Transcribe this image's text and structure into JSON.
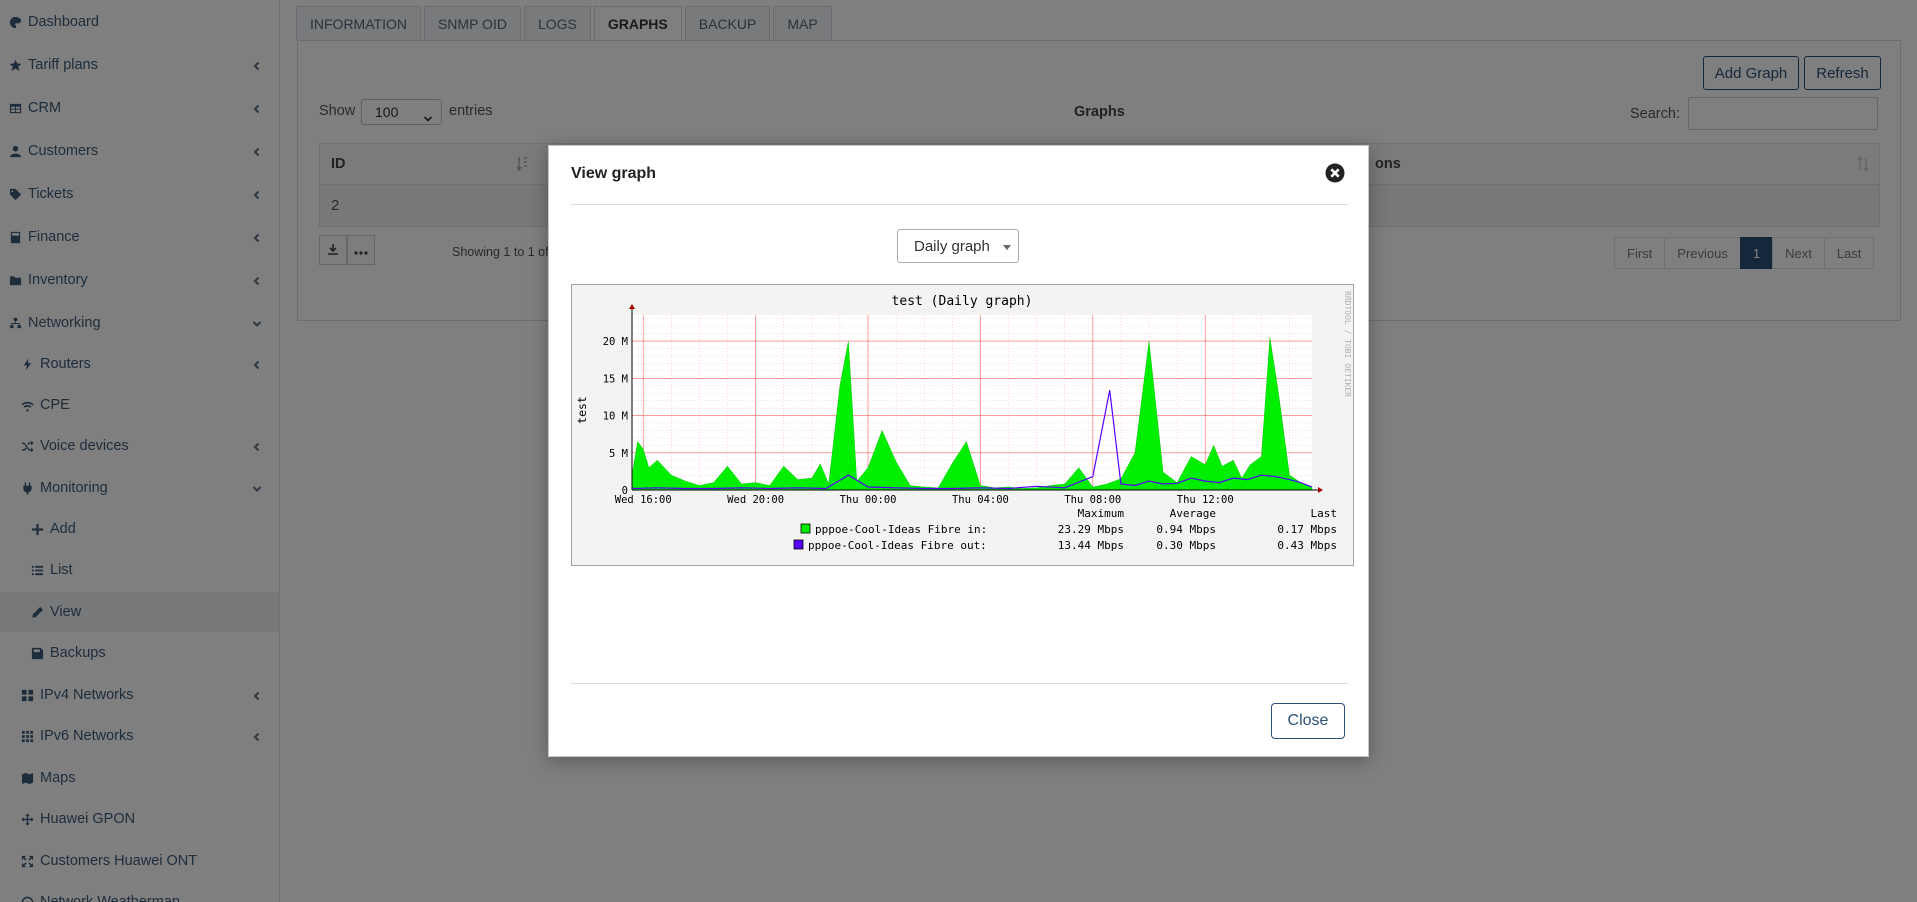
{
  "sidebar": {
    "items": [
      {
        "label": "Dashboard",
        "icon": "palette-icon",
        "caret": false
      },
      {
        "label": "Tariff plans",
        "icon": "star-icon",
        "caret": true
      },
      {
        "label": "CRM",
        "icon": "table-icon",
        "caret": true
      },
      {
        "label": "Customers",
        "icon": "user-icon",
        "caret": true
      },
      {
        "label": "Tickets",
        "icon": "tag-icon",
        "caret": true
      },
      {
        "label": "Finance",
        "icon": "calculator-icon",
        "caret": true
      },
      {
        "label": "Inventory",
        "icon": "folder-icon",
        "caret": true
      },
      {
        "label": "Networking",
        "icon": "network-icon",
        "caret": true,
        "open": true
      },
      {
        "label": "Routers",
        "icon": "bolt-icon",
        "caret": true
      },
      {
        "label": "CPE",
        "icon": "wifi-icon",
        "caret": false
      },
      {
        "label": "Voice devices",
        "icon": "shuffle-icon",
        "caret": true
      },
      {
        "label": "Monitoring",
        "icon": "plug-icon",
        "caret": true,
        "open": true
      },
      {
        "label": "Add",
        "icon": "plus-icon",
        "caret": false
      },
      {
        "label": "List",
        "icon": "list-icon",
        "caret": false
      },
      {
        "label": "View",
        "icon": "pencil-icon",
        "caret": false,
        "active": true
      },
      {
        "label": "Backups",
        "icon": "disk-icon",
        "caret": false
      },
      {
        "label": "IPv4 Networks",
        "icon": "grid-icon",
        "caret": true
      },
      {
        "label": "IPv6 Networks",
        "icon": "grid-small-icon",
        "caret": true
      },
      {
        "label": "Maps",
        "icon": "map-icon",
        "caret": false
      },
      {
        "label": "Huawei GPON",
        "icon": "arrows-icon",
        "caret": false
      },
      {
        "label": "Customers Huawei ONT",
        "icon": "expand-icon",
        "caret": false
      },
      {
        "label": "Network Weathermap",
        "icon": "circle-icon",
        "caret": false
      }
    ]
  },
  "tabs": [
    "INFORMATION",
    "SNMP OID",
    "LOGS",
    "GRAPHS",
    "BACKUP",
    "MAP"
  ],
  "active_tab": "GRAPHS",
  "panel": {
    "add_graph": "Add Graph",
    "refresh": "Refresh",
    "show_label": "Show",
    "show_value": "100",
    "entries_label": "entries",
    "table_title": "Graphs",
    "search_label": "Search:",
    "col_id": "ID",
    "col_actions_partial": "ons",
    "row_id": "2",
    "showing": "Showing 1 to 1 of",
    "pager": [
      "First",
      "Previous",
      "1",
      "Next",
      "Last"
    ]
  },
  "modal": {
    "title": "View graph",
    "select_value": "Daily graph",
    "close_label": "Close"
  },
  "colors": {
    "accent": "#2b5177",
    "in_fill": "#00ee00",
    "out_line": "#5500ff",
    "grid_minor": "#ffaaaa"
  },
  "chart_data": {
    "type": "area",
    "title": "test (Daily graph)",
    "ylabel": "test",
    "watermark": "RRDTOOL / TOBI OETIKER",
    "y_ticks": [
      "0",
      "5 M",
      "10 M",
      "15 M",
      "20 M"
    ],
    "ylim": [
      0,
      23.5
    ],
    "x_ticks": [
      "Wed 16:00",
      "Wed 20:00",
      "Thu 00:00",
      "Thu 04:00",
      "Thu 08:00",
      "Thu 12:00"
    ],
    "xlim_hours": [
      15.6,
      39.8
    ],
    "legend_headers": [
      "Maximum",
      "Average",
      "Last"
    ],
    "series": [
      {
        "name": "pppoe-Cool-Ideas Fibre in:",
        "maximum": "23.29 Mbps",
        "average": "0.94 Mbps",
        "last": "0.17 Mbps",
        "x": [
          15.6,
          15.8,
          16.0,
          16.2,
          16.5,
          17.0,
          17.5,
          18.0,
          18.5,
          19.0,
          19.5,
          20.0,
          20.5,
          21.0,
          21.5,
          22.0,
          22.3,
          22.6,
          23.0,
          23.3,
          23.6,
          24.0,
          24.5,
          25.0,
          25.5,
          26.0,
          26.5,
          27.0,
          27.5,
          28.0,
          28.5,
          29.0,
          29.5,
          30.0,
          30.5,
          31.0,
          31.5,
          32.0,
          32.5,
          33.0,
          33.5,
          34.0,
          34.5,
          35.0,
          35.5,
          36.0,
          36.3,
          36.6,
          37.0,
          37.3,
          37.6,
          38.0,
          38.3,
          38.6,
          39.0,
          39.4,
          39.8
        ],
        "y": [
          2.0,
          6.5,
          5.5,
          3.0,
          4.0,
          2.0,
          1.2,
          0.6,
          1.0,
          3.2,
          0.8,
          1.0,
          0.6,
          3.2,
          1.4,
          1.6,
          3.5,
          0.8,
          14.0,
          20.0,
          1.2,
          3.0,
          8.0,
          3.8,
          0.6,
          0.4,
          0.3,
          3.6,
          6.5,
          0.6,
          0.3,
          0.4,
          0.2,
          0.3,
          0.6,
          0.8,
          3.0,
          0.4,
          0.8,
          1.5,
          5.0,
          20.0,
          2.4,
          1.0,
          4.5,
          3.4,
          6.0,
          3.2,
          4.0,
          1.6,
          3.4,
          4.5,
          20.5,
          13.2,
          2.0,
          1.0,
          0.3
        ]
      },
      {
        "name": "pppoe-Cool-Ideas Fibre out:",
        "maximum": "13.44 Mbps",
        "average": "0.30 Mbps",
        "last": "0.43 Mbps",
        "x": [
          15.6,
          16.5,
          17.5,
          18.5,
          19.5,
          20.5,
          21.5,
          22.5,
          23.3,
          24.0,
          25.0,
          26.0,
          27.0,
          28.0,
          29.0,
          30.0,
          31.0,
          32.0,
          32.6,
          33.0,
          33.5,
          34.0,
          34.5,
          35.0,
          35.5,
          36.0,
          36.5,
          37.0,
          37.5,
          38.0,
          38.5,
          39.0,
          39.4,
          39.8
        ],
        "y": [
          0.2,
          0.3,
          0.2,
          0.2,
          0.3,
          0.2,
          0.3,
          0.2,
          2.0,
          0.4,
          0.3,
          0.2,
          0.2,
          0.3,
          0.2,
          0.5,
          0.3,
          1.8,
          13.4,
          0.8,
          0.6,
          1.2,
          0.8,
          0.9,
          1.6,
          1.2,
          1.0,
          1.6,
          1.4,
          2.0,
          1.8,
          1.4,
          1.0,
          0.4
        ]
      }
    ]
  }
}
